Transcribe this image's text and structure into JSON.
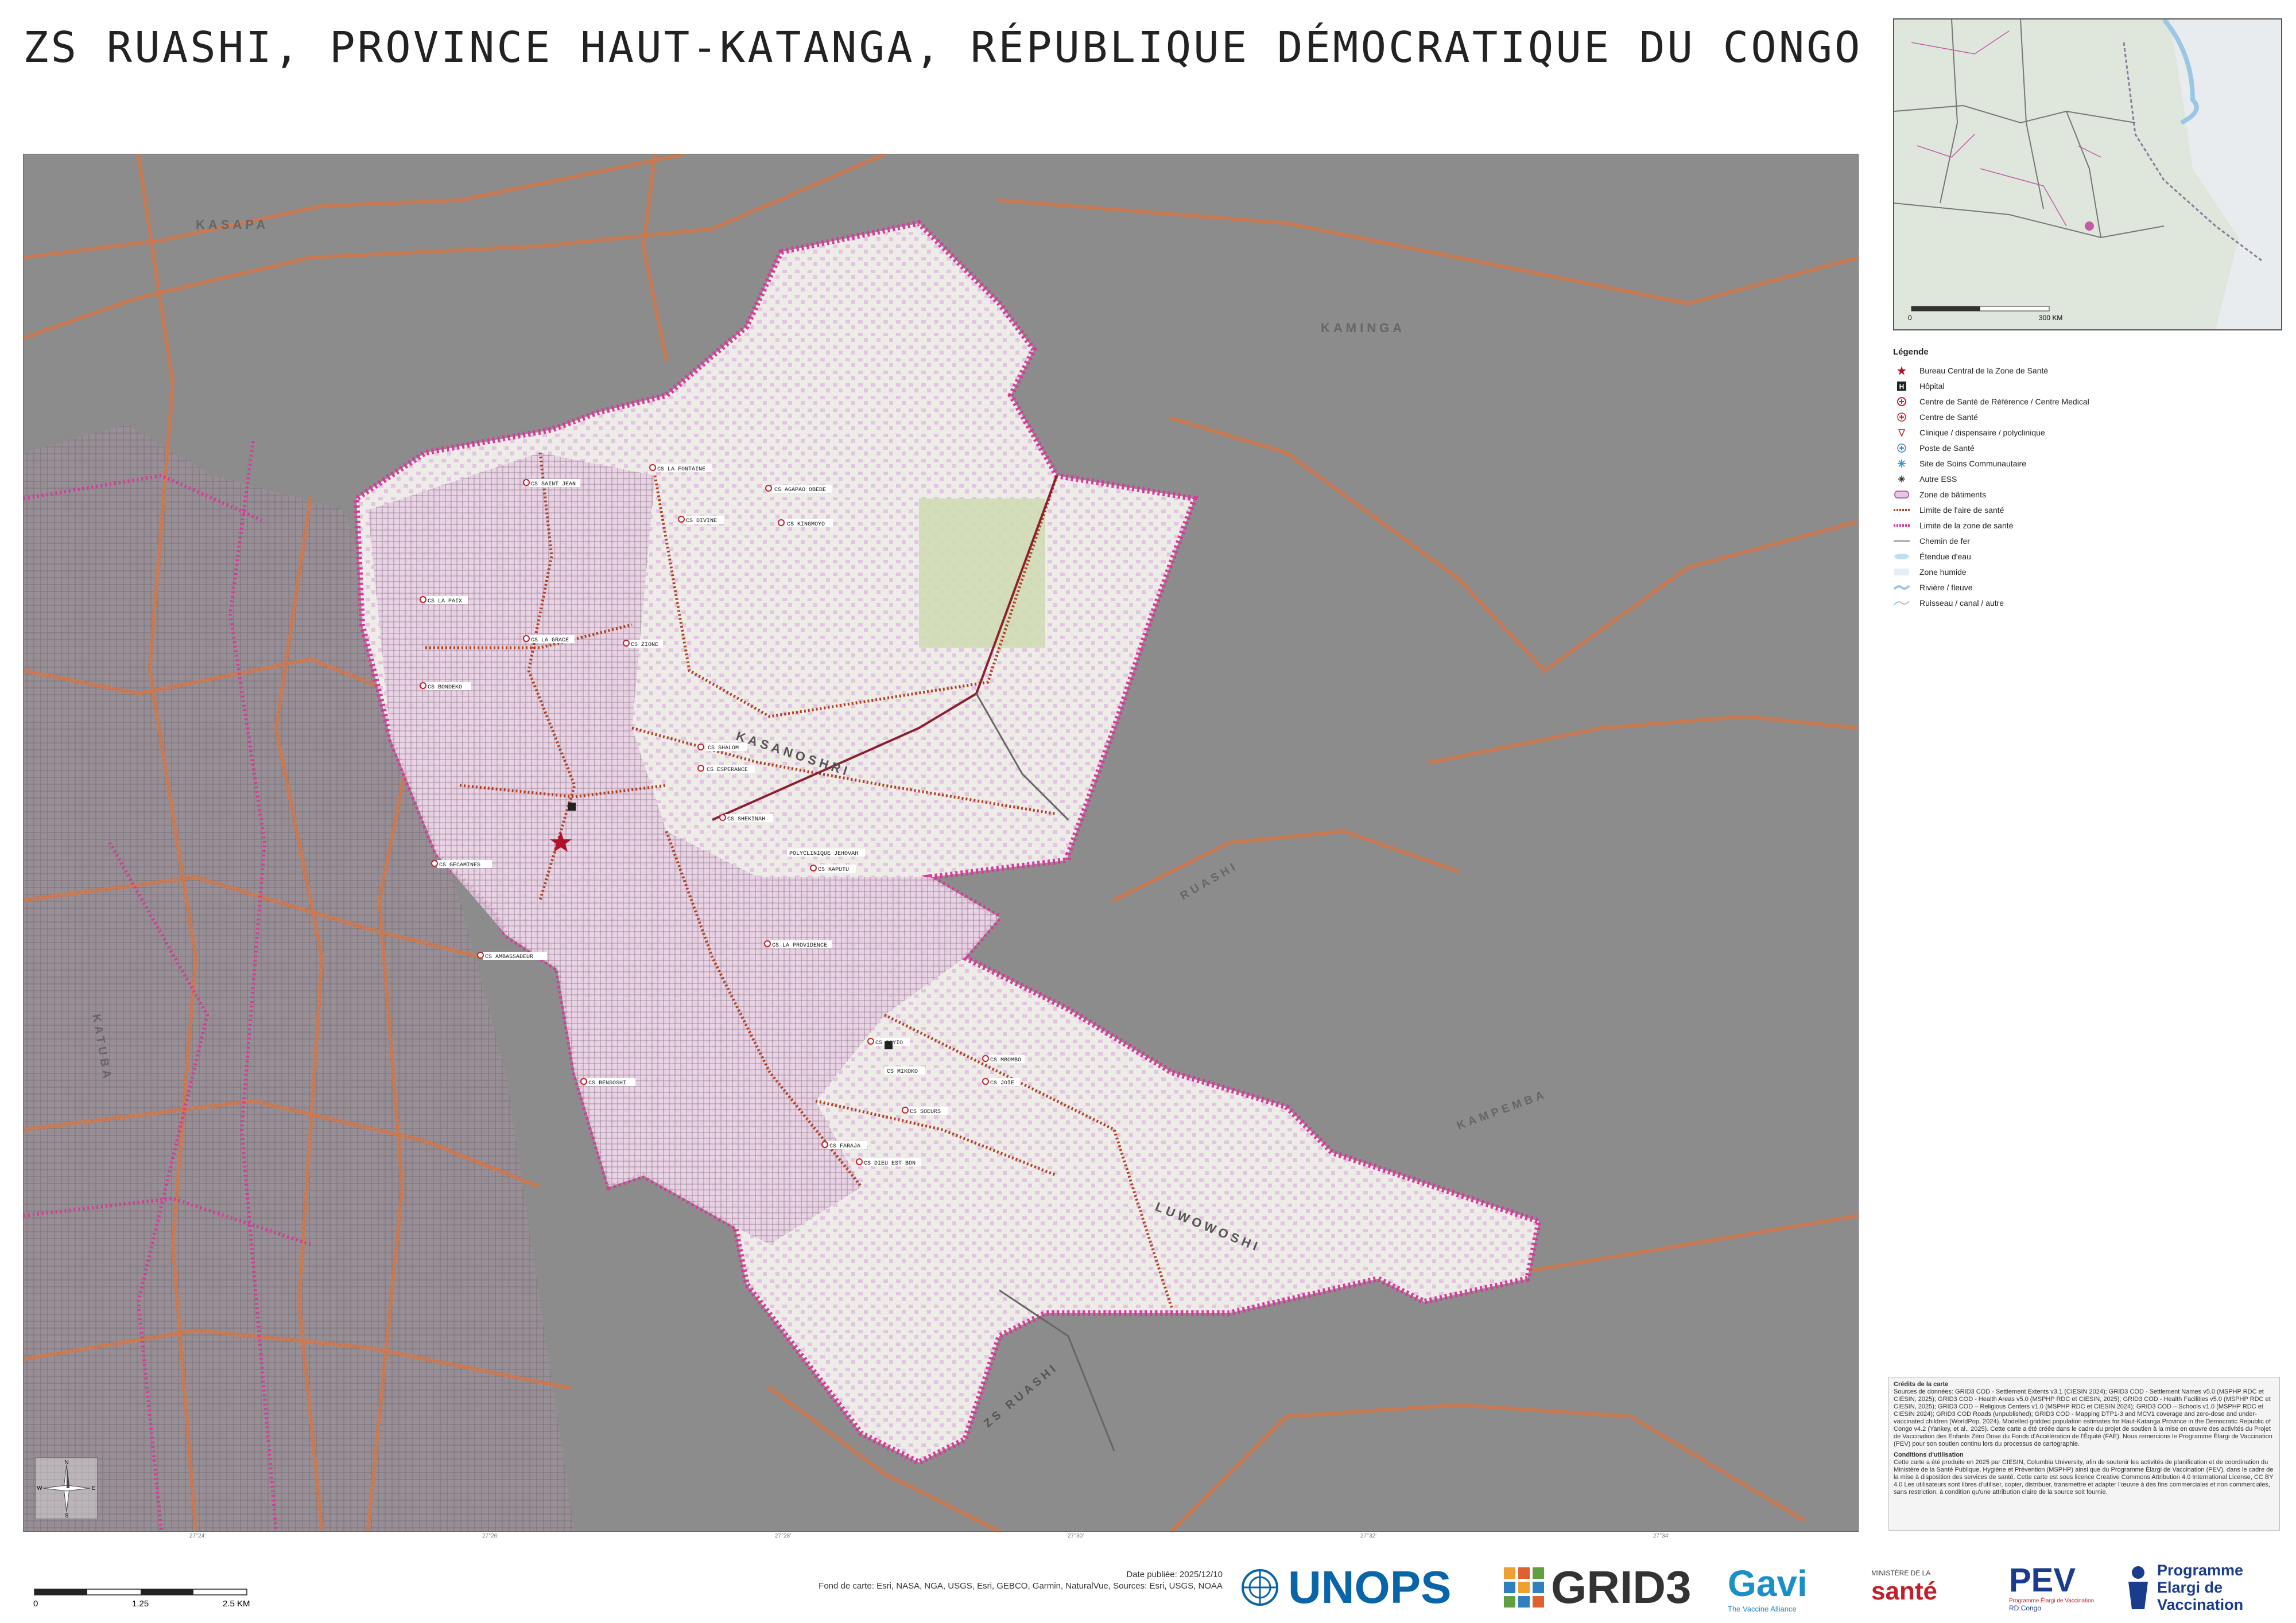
{
  "title": "ZS RUASHI, PROVINCE HAUT-KATANGA, RÉPUBLIQUE DÉMOCRATIQUE DU CONGO",
  "colors": {
    "background_gray": "#8c8c8c",
    "zone_fill": "#eeece6",
    "zone_border": "#d63a9a",
    "building_fill": "#e6c6e6",
    "aire_boundary": "#b04020",
    "road": "#c97a52",
    "railway": "#8a2030"
  },
  "map": {
    "labels": [
      "KASAPA",
      "KAMINGA",
      "KASANOSHRI",
      "LUWOWOSHI",
      "ZS RUASHI",
      "RUASHI",
      "KATUBA",
      "KAMPEMBA"
    ],
    "poi_labels": [
      "CS SHALOM",
      "CS ESPERANCE",
      "CS LA FONTAINE",
      "CS AGAPAO OBEDE",
      "CS KINGMOYO",
      "CS DIVINE",
      "CS SAINT JEAN",
      "CS LA PAIX",
      "CS LA GRACE",
      "CS BONDEKO",
      "CS SHEKINAH",
      "CS GECAMINES",
      "CS KAPUTU",
      "CS AMBASSADEUR",
      "POLYCLINIQUE JEHOVAH",
      "CS LA PROVIDENCE",
      "CS BENSOSHI",
      "CS ZIONE",
      "CS SAYIO",
      "CS MIKOKO",
      "CS FARAJA",
      "CS SOEURS",
      "CS DIEU EST BON",
      "CS MBOMBO",
      "CS JOIE"
    ]
  },
  "inset": {
    "scale_start": "0",
    "scale_end": "300 KM"
  },
  "legend": {
    "title": "Légende",
    "items": [
      {
        "icon": "star-icon",
        "label": "Bureau Central de la Zone de Santé"
      },
      {
        "icon": "hospital-icon",
        "label": "Hôpital"
      },
      {
        "icon": "reference-center-icon",
        "label": "Centre de Santé de Référence / Centre Medical"
      },
      {
        "icon": "health-center-icon",
        "label": "Centre de Santé"
      },
      {
        "icon": "clinic-icon",
        "label": "Clinique / dispensaire / polyclinique"
      },
      {
        "icon": "health-post-icon",
        "label": "Poste de Santé"
      },
      {
        "icon": "community-site-icon",
        "label": "Site de Soins Communautaire"
      },
      {
        "icon": "other-ess-icon",
        "label": "Autre ESS"
      },
      {
        "icon": "building-zone-icon",
        "label": "Zone de bâtiments"
      },
      {
        "icon": "aire-limit-icon",
        "label": "Limite de l'aire de santé"
      },
      {
        "icon": "zone-limit-icon",
        "label": "Limite de la zone de santé"
      },
      {
        "icon": "railway-icon",
        "label": "Chemin de fer"
      },
      {
        "icon": "water-icon",
        "label": "Étendue d'eau"
      },
      {
        "icon": "wetland-icon",
        "label": "Zone humide"
      },
      {
        "icon": "river-icon",
        "label": "Rivière / fleuve"
      },
      {
        "icon": "stream-icon",
        "label": "Ruisseau / canal / autre"
      }
    ]
  },
  "credits": {
    "heading": "Crédits de la carte",
    "sources": "Sources de données: GRID3 COD - Settlement Extents v3.1 (CIESIN 2024); GRID3 COD - Settlement Names v5.0 (MSPHP RDC et CIESIN, 2025); GRID3 COD - Health Areas v5.0 (MSPHP RDC et CIESIN, 2025); GRID3 COD - Health Facilities v5.0 (MSPHP RDC et CIESIN, 2025); GRID3 COD – Religious Centers v1.0 (MSPHP RDC et CIESIN 2024); GRID3 COD – Schools v1.0 (MSPHP RDC et CIESIN 2024); GRID3 COD Roads (unpublished); GRID3 COD - Mapping DTP1-3 and MCV1 coverage and zero-dose and under-vaccinated children (WorldPop, 2024). Modelled gridded population estimates for Haut-Katanga Province in the Democratic Republic of Congo v4.2 (Yankey, et al., 2025). Cette carte a été créée dans le cadre du projet de soutien à la mise en œuvre des activités du Projet de Vaccination des Enfants Zéro Dose du Fonds d'Accélération de l'Équité (FAE). Nous remercions le Programme Élargi de Vaccination (PEV) pour son soutien continu lors du processus de cartographie.",
    "conditions_heading": "Conditions d'utilisation",
    "conditions": "Cette carte a été produite en 2025 par CIESIN, Columbia University, afin de soutenir les activités de planification et de coordination du Ministère de la Santé Publique, Hygiène et Prévention (MSPHP) ainsi que du Programme Élargi de Vaccination (PEV), dans le cadre de la mise à disposition des services de santé. Cette carte est sous licence Creative Commons Attribution 4.0 International License, CC BY 4.0 Les utilisateurs sont libres d'utiliser, copier, distribuer, transmettre et adapter l'œuvre à des fins commerciales et non commerciales, sans restriction, à condition qu'une attribution claire de la source soit fournie."
  },
  "scale": {
    "ticks": [
      "0",
      "1.25",
      "2.5 KM"
    ]
  },
  "meta": {
    "date": "Date publiée: 2025/12/10",
    "basemap": "Fond de carte: Esri, NASA, NGA, USGS, Esri, GEBCO, Garmin, NaturalVue, Sources: Esri, USGS, NOAA"
  },
  "compass": {
    "n": "N",
    "s": "S",
    "e": "E",
    "w": "W"
  },
  "logos": {
    "unops": "UNOPS",
    "grid3": "GRID3",
    "gavi": "Gavi",
    "gavi_tag": "The Vaccine Alliance",
    "ministry_top": "MINISTÈRE DE LA",
    "ministry": "santé",
    "pev": "PEV",
    "pev_sub": "Programme Élargi de Vaccination",
    "pev_country": "RD.Congo",
    "pev_full_1": "Programme",
    "pev_full_2": "Elargi de",
    "pev_full_3": "Vaccination"
  }
}
